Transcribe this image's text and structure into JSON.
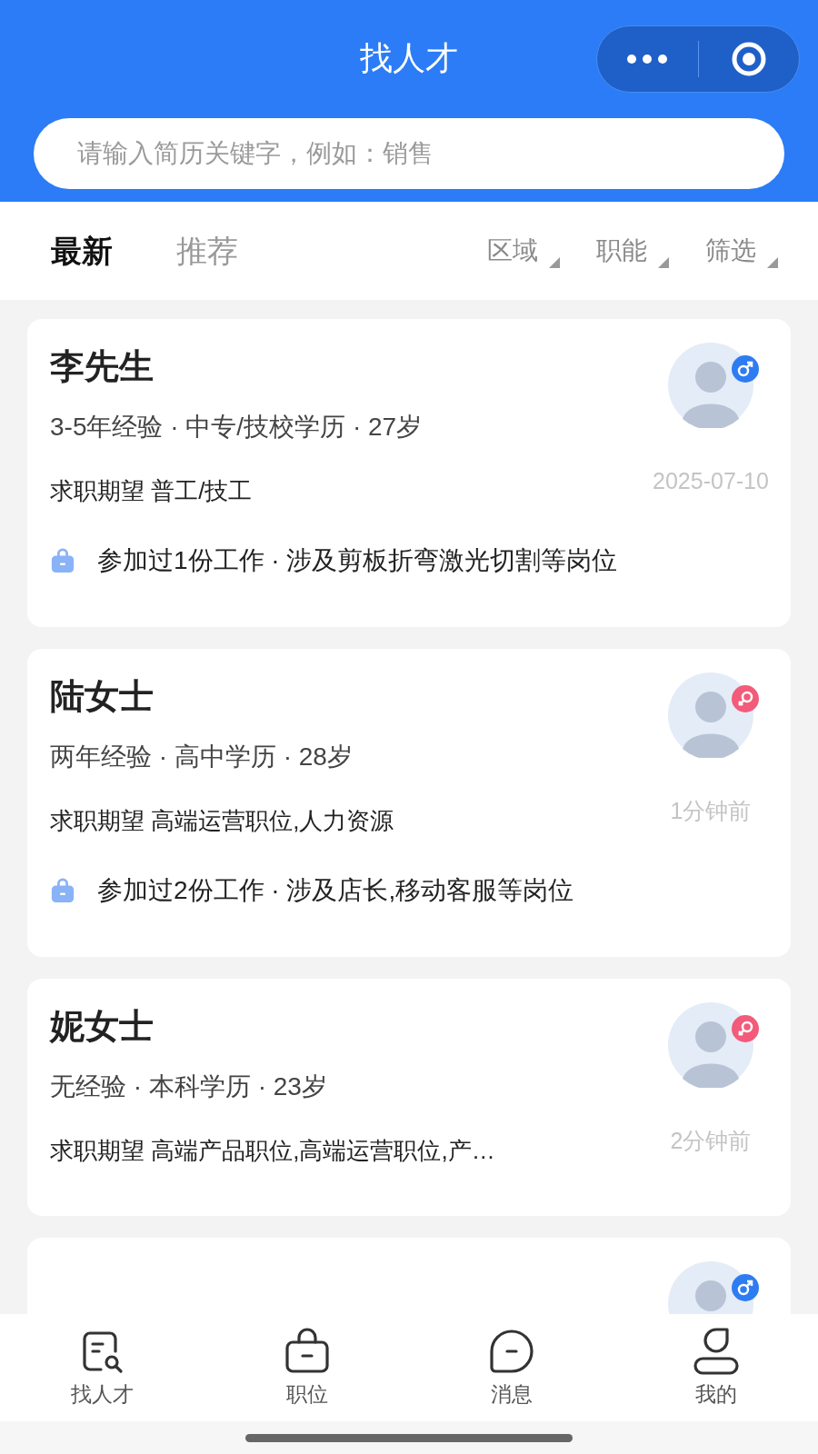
{
  "header": {
    "title": "找人才",
    "search": {
      "placeholder": "请输入简历关键字，例如：销售"
    }
  },
  "tabs": [
    {
      "label": "最新",
      "selected": true
    },
    {
      "label": "推荐",
      "selected": false
    }
  ],
  "filters": [
    "区域",
    "职能",
    "筛选"
  ],
  "candidates": [
    {
      "name": "李先生",
      "kind": "male",
      "details": "3-5年经验 · 中专/技校学历 · 27岁",
      "time": "2025-07-10",
      "expectation": "求职期望 普工/技工",
      "work": "参加过1份工作 · 涉及剪板折弯激光切割等岗位"
    },
    {
      "name": "陆女士",
      "kind": "female",
      "details": "两年经验 · 高中学历 · 28岁",
      "time": "1分钟前",
      "expectation": "求职期望 高端运营职位,人力资源",
      "work": "参加过2份工作 · 涉及店长,移动客服等岗位"
    },
    {
      "name": "妮女士",
      "kind": "female",
      "details": "无经验 · 本科学历 · 23岁",
      "time": "2分钟前",
      "expectation": "求职期望 高端产品职位,高端运营职位,产…"
    },
    {
      "kind": "male"
    }
  ],
  "bottom_nav": [
    {
      "label": "找人才",
      "kind": "search"
    },
    {
      "label": "职位",
      "kind": "job"
    },
    {
      "label": "消息",
      "kind": "message"
    },
    {
      "label": "我的",
      "kind": "profile"
    }
  ]
}
